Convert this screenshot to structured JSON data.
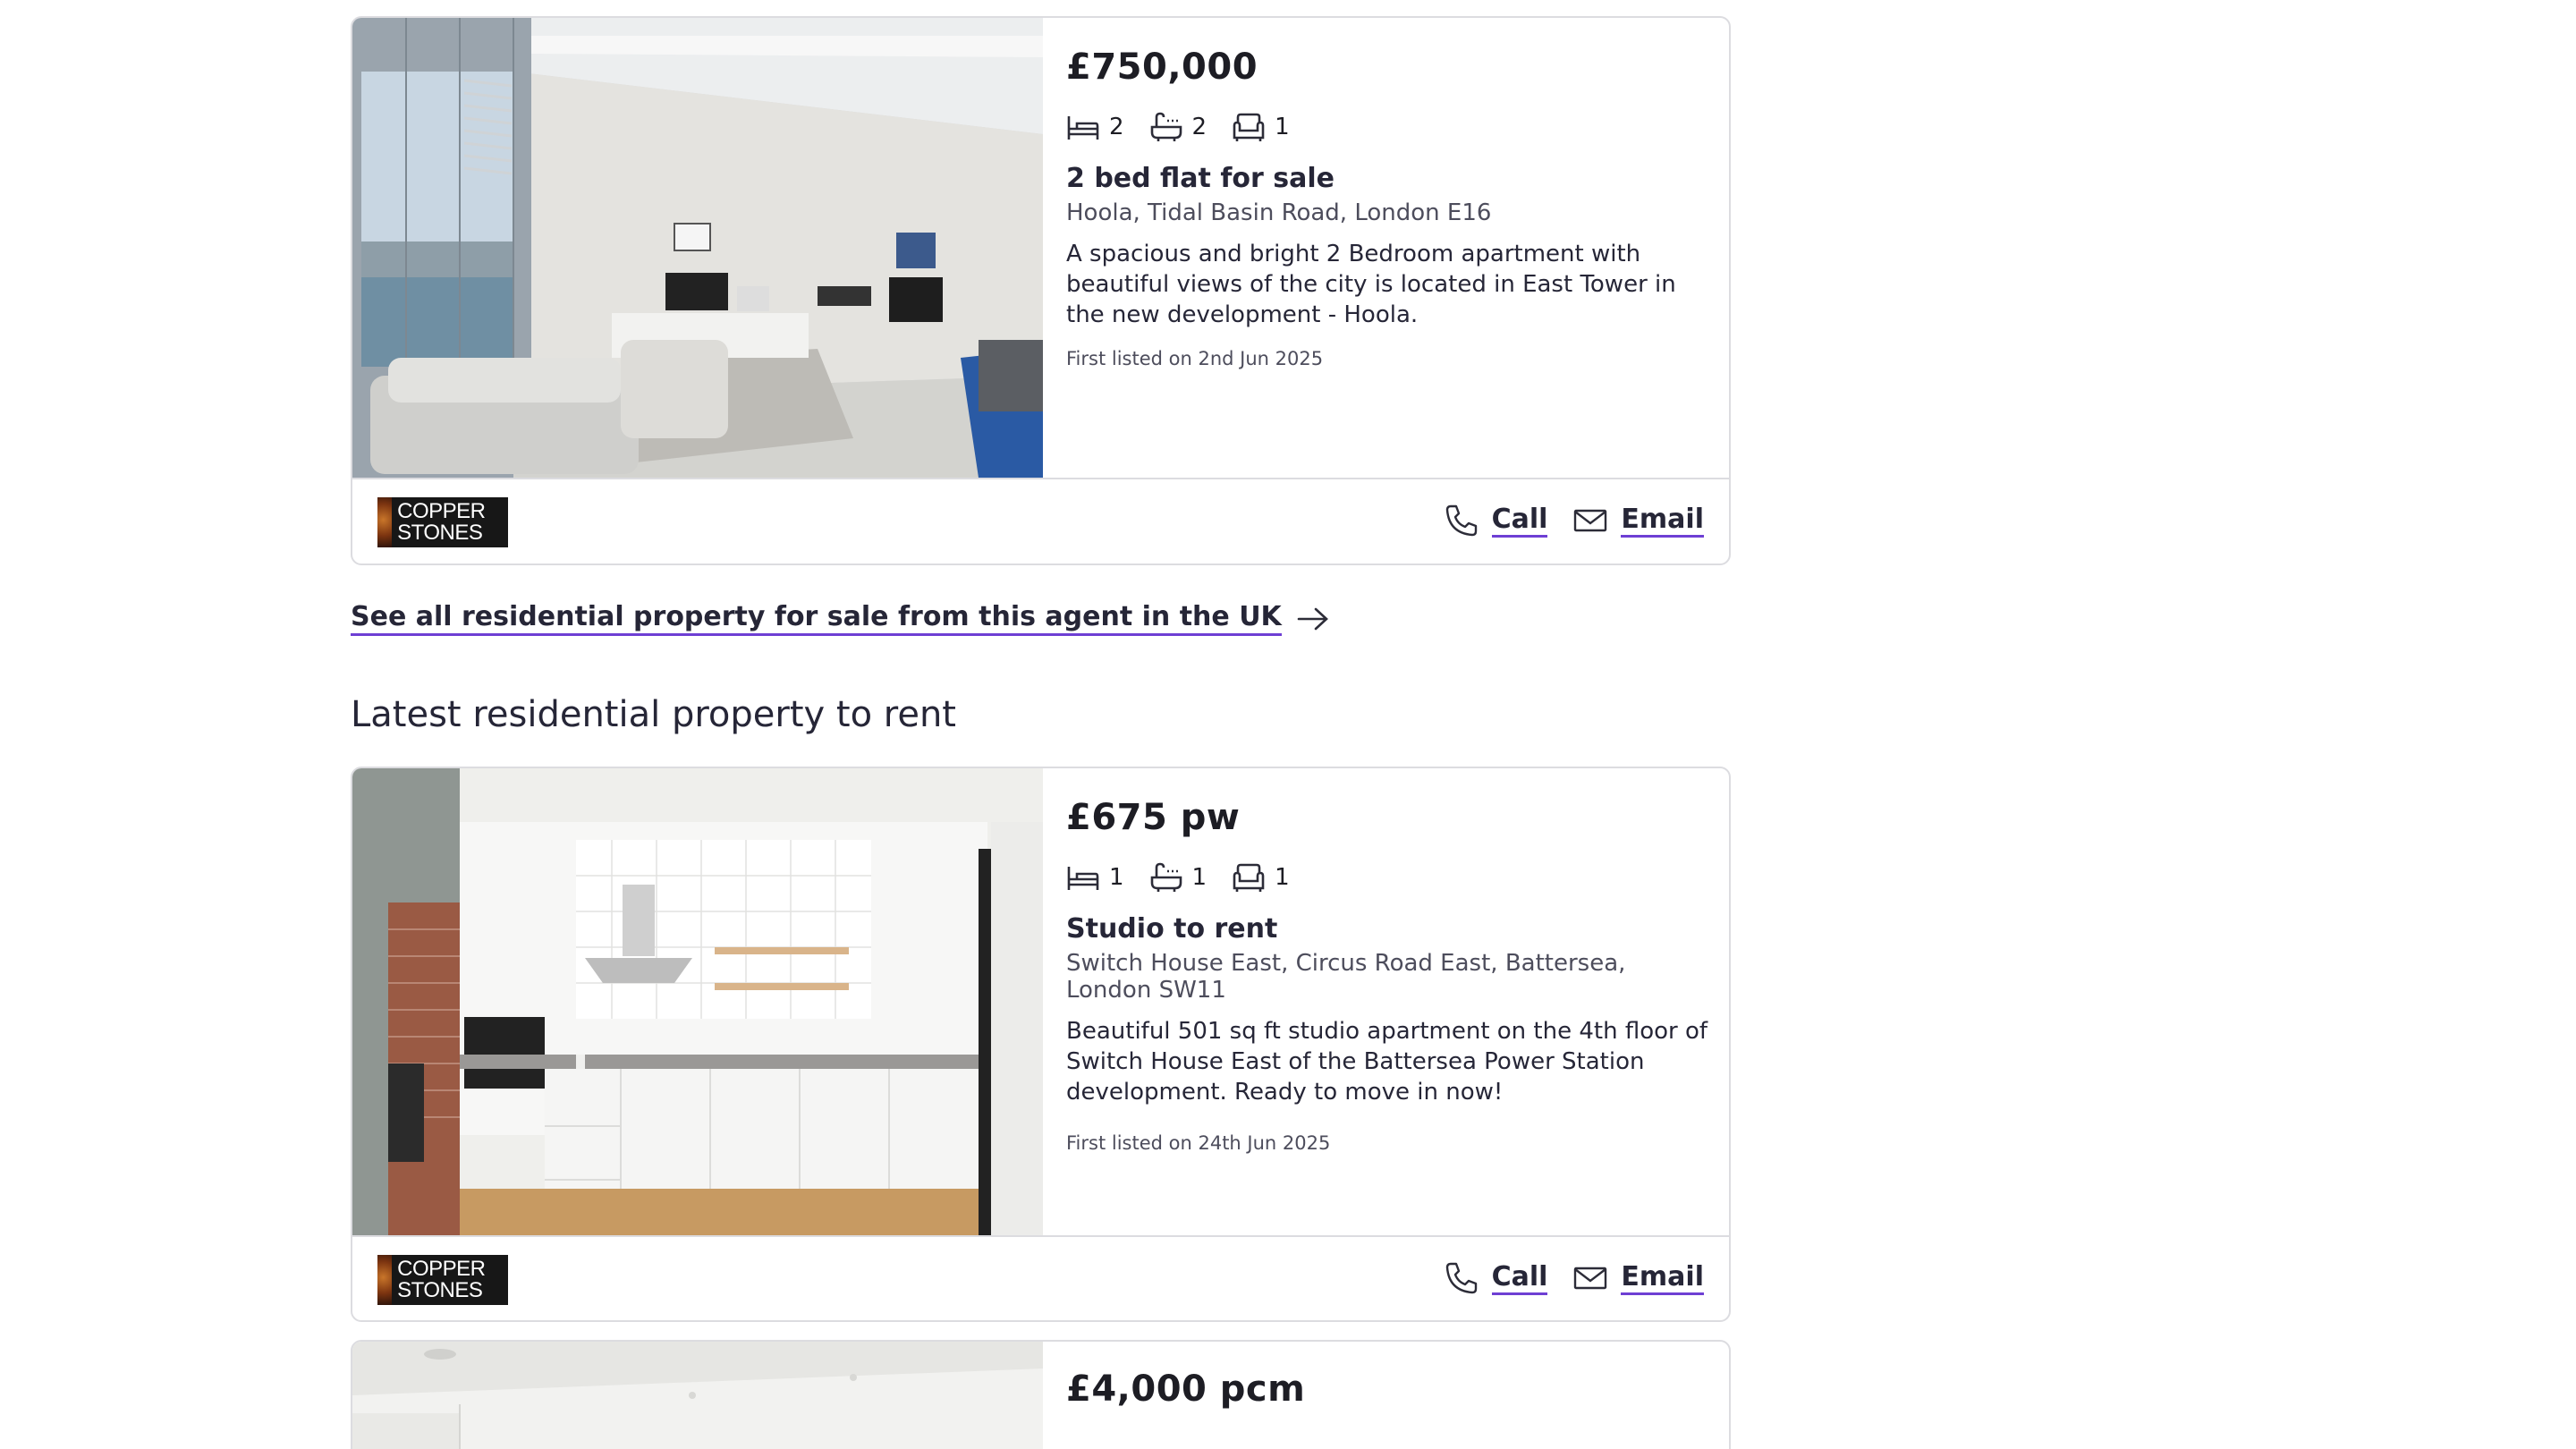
{
  "listings_sale": [
    {
      "price": "£750,000",
      "beds": "2",
      "baths": "2",
      "receptions": "1",
      "title": "2 bed flat for sale",
      "address": "Hoola, Tidal Basin Road, London E16",
      "description": "A spacious and bright 2 Bedroom apartment with beautiful views of the city is located in East Tower in the new development - Hoola.",
      "listed": "First listed on 2nd Jun 2025",
      "agent_logo": "COPPER STONES",
      "call_label": "Call",
      "email_label": "Email"
    }
  ],
  "agent_link": {
    "label": "See all residential property for sale from this agent in the UK",
    "icon": "arrow-right-icon"
  },
  "rent_section": {
    "title": "Latest residential property to rent"
  },
  "listings_rent": [
    {
      "price": "£675 pw",
      "beds": "1",
      "baths": "1",
      "receptions": "1",
      "title": "Studio to rent",
      "address": "Switch House East, Circus Road East, Battersea, London SW11",
      "description": "Beautiful 501 sq ft studio apartment on the 4th floor of Switch House East of the Battersea Power Station development. Ready to move in now!",
      "listed": "First listed on 24th Jun 2025",
      "agent_logo": "COPPER STONES",
      "call_label": "Call",
      "email_label": "Email"
    },
    {
      "price": "£4,000 pcm"
    }
  ],
  "colors": {
    "link_underline": "#6e3fd4",
    "border": "#dcdce0",
    "text": "#262637"
  },
  "icons": [
    "bed-icon",
    "bath-icon",
    "sofa-icon",
    "phone-icon",
    "mail-icon",
    "arrow-right-icon"
  ]
}
